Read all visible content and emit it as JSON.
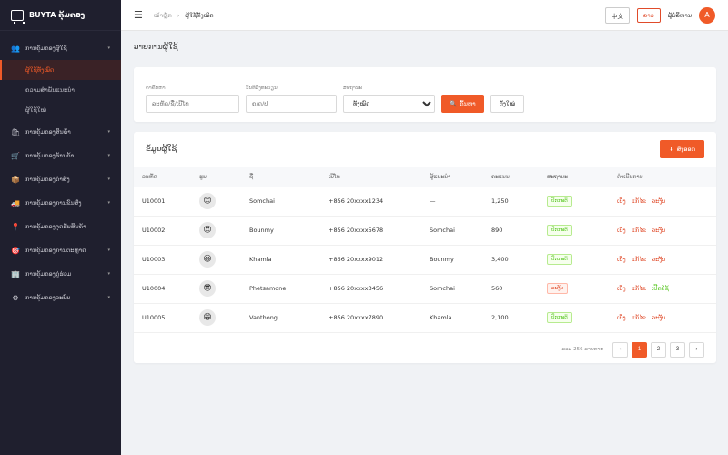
{
  "brand": {
    "title": "BUYTA ຄຸ້ມຄອງ"
  },
  "sidebar": {
    "groups": [
      {
        "icon": "👥",
        "label": "ການຄຸ້ມຄອງຜູ້ໃຊ້",
        "chev": "▾"
      },
      {
        "icon": "🛍",
        "label": "ການຄຸ້ມຄອງສິນຄ້າ",
        "chev": "▾"
      },
      {
        "icon": "🛒",
        "label": "ການຄຸ້ມຄອງຮ້ານຄ້າ",
        "chev": "▾"
      },
      {
        "icon": "📦",
        "label": "ການຄຸ້ມຄອງຄຳສັ່ງ",
        "chev": "▾"
      },
      {
        "icon": "🚚",
        "label": "ການຄຸ້ມຄອງການຂົນສົ່ງ",
        "chev": "▾"
      },
      {
        "icon": "📍",
        "label": "ການຄຸ້ມຄອງຈຸດຮັບສິນຄ້າ",
        "chev": ""
      },
      {
        "icon": "🎯",
        "label": "ການຄຸ້ມຄອງການຕະຫຼາດ",
        "chev": "▾"
      },
      {
        "icon": "🏢",
        "label": "ການຄຸ້ມຄອງຄູ່ຮ່ວມ",
        "chev": "▾"
      },
      {
        "icon": "⚙",
        "label": "ການຄຸ້ມຄອງລະບົບ",
        "chev": "▾"
      }
    ],
    "subitems": [
      "ຜູ້ໃຊ້ທັງໝົດ",
      "ຄວາມສຳພັນແນະນຳ",
      "ຜູ້ໃຊ້ໃໝ່"
    ]
  },
  "topbar": {
    "crumb_home": "ໜ້າຫຼັກ",
    "crumb_sep": "›",
    "crumb_current": "ຜູ້ໃຊ້ທັງໝົດ",
    "lang_zh": "中文",
    "lang_lo": "ລາວ",
    "username": "ຜູ້ບໍລິຫານ",
    "avatar": "A"
  },
  "page": {
    "title": "ລາຍການຜູ້ໃຊ້"
  },
  "filters": {
    "keyword_label": "ຄຳຄົ້ນຫາ",
    "keyword_placeholder": "ລະຫັດ/ຊື່/ເບີໂທ",
    "date_label": "ວັນທີລົງທະບຽນ",
    "date_placeholder": "ຄ/ດ/ປ",
    "status_label": "ສະຖານະ",
    "status_value": "ທັງໝົດ",
    "search_icon": "🔍",
    "search_label": "ຄົ້ນຫາ",
    "reset_label": "ຕັ້ງໃໝ່"
  },
  "list": {
    "title": "ຂໍ້ມູນຜູ້ໃຊ້",
    "export_icon": "⬇",
    "export_label": "ສົ່ງອອກ",
    "headers": [
      "ລະຫັດ",
      "ຮູບ",
      "ຊື່",
      "ເບີໂທ",
      "ຜູ້ແນະນຳ",
      "ຄະແນນ",
      "ສະຖານະ",
      "ດຳເນີນການ"
    ],
    "rows": [
      {
        "id": "U10001",
        "avatar": "😊",
        "name": "Somchai",
        "phone": "+856 20xxxx1234",
        "referrer": "—",
        "points": "1,250",
        "status": "ປົກກະຕິ",
        "status_type": "ok",
        "actions": [
          "ເບິ່ງ",
          "ແກ້ໄຂ",
          "ລະງັບ"
        ]
      },
      {
        "id": "U10002",
        "avatar": "😍",
        "name": "Bounmy",
        "phone": "+856 20xxxx5678",
        "referrer": "Somchai",
        "points": "890",
        "status": "ປົກກະຕິ",
        "status_type": "ok",
        "actions": [
          "ເບິ່ງ",
          "ແກ້ໄຂ",
          "ລະງັບ"
        ]
      },
      {
        "id": "U10003",
        "avatar": "😃",
        "name": "Khamla",
        "phone": "+856 20xxxx9012",
        "referrer": "Bounmy",
        "points": "3,400",
        "status": "ປົກກະຕິ",
        "status_type": "ok",
        "actions": [
          "ເບິ່ງ",
          "ແກ້ໄຂ",
          "ລະງັບ"
        ]
      },
      {
        "id": "U10004",
        "avatar": "😎",
        "name": "Phetsamone",
        "phone": "+856 20xxxx3456",
        "referrer": "Somchai",
        "points": "560",
        "status": "ລະງັບ",
        "status_type": "bad",
        "actions": [
          "ເບິ່ງ",
          "ແກ້ໄຂ",
          "ເປີດໃຊ້"
        ]
      },
      {
        "id": "U10005",
        "avatar": "😁",
        "name": "Vanthong",
        "phone": "+856 20xxxx7890",
        "referrer": "Khamla",
        "points": "2,100",
        "status": "ປົກກະຕິ",
        "status_type": "ok",
        "actions": [
          "ເບິ່ງ",
          "ແກ້ໄຂ",
          "ລະງັບ"
        ]
      }
    ]
  },
  "pagination": {
    "total": "ລວມ 256 ລາຍການ",
    "prev": "‹",
    "pages": [
      "1",
      "2",
      "3"
    ],
    "next": "›",
    "current": "1"
  },
  "colors": {
    "accent": "#f05a28",
    "sidebar": "#1f1f2e",
    "ok": "#52c41a"
  }
}
